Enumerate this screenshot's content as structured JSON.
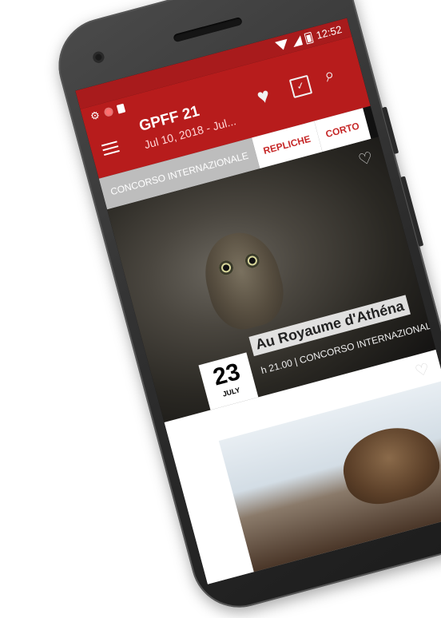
{
  "status_bar": {
    "time": "12:52"
  },
  "app_bar": {
    "title": "GPFF 21",
    "subtitle": "Jul 10, 2018 - Jul...",
    "favorites_icon": "heart-icon",
    "calendar_icon": "calendar-icon",
    "search_icon": "search-icon"
  },
  "tabs": [
    {
      "label": "CONCORSO INTERNAZIONALE",
      "active": true
    },
    {
      "label": "REPLICHE",
      "active": false
    },
    {
      "label": "CORTO",
      "active": false
    }
  ],
  "film_card": {
    "title": "Au Royaume d'Athéna",
    "time": "h 21.00",
    "category": "CONCORSO INTERNAZIONALE",
    "day": "23",
    "month": "JULY"
  },
  "colors": {
    "primary": "#b71c1c",
    "tab_active": "#bdbdbd",
    "tab_text": "#c62828"
  }
}
